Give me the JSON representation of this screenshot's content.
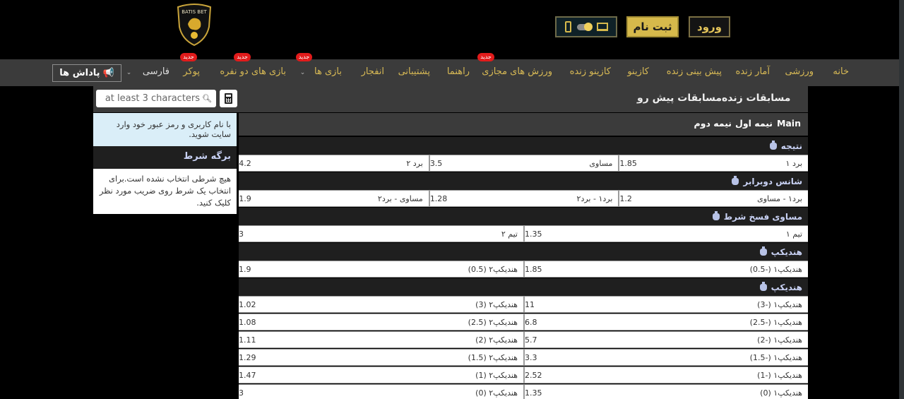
{
  "header": {
    "logo_text": "BATIS BET",
    "login_label": "ورود",
    "register_label": "ثبت نام",
    "device_toggle": {
      "left_icon": "phone-icon",
      "right_icon": "laptop-icon",
      "selected": "desktop"
    }
  },
  "nav": {
    "items": [
      {
        "label": "خانه",
        "badge": null
      },
      {
        "label": "ورزشی",
        "badge": null
      },
      {
        "label": "آمار زنده",
        "badge": null
      },
      {
        "label": "پیش بینی زنده",
        "badge": null
      },
      {
        "label": "کازینو",
        "badge": null
      },
      {
        "label": "کازینو زنده",
        "badge": null
      },
      {
        "label": "ورزش های مجازی",
        "badge": "جدید"
      },
      {
        "label": "راهنما",
        "badge": null
      },
      {
        "label": "پشتیبانی",
        "badge": null
      },
      {
        "label": "انفجار",
        "badge": null
      },
      {
        "label": "بازی ها",
        "badge": "جدید",
        "dropdown": true
      },
      {
        "label": "بازی های دو نفره",
        "badge": "جدید"
      },
      {
        "label": "پوکر",
        "badge": "جدید"
      }
    ],
    "language": "فارسی",
    "rewards_label": "پاداش ها"
  },
  "search": {
    "placeholder": "at least 3 characters"
  },
  "tabs": {
    "live": "مسابقات زنده",
    "upcoming": "مسابقات پیش رو"
  },
  "sidebar": {
    "login_note": "با نام کاربری و رمز عبور خود وارد سایت شوید.",
    "betslip_title": "برگه شرط",
    "betslip_empty": "هیچ شرطی انتخاب نشده است.برای انتخاب یک شرط روی ضریب مورد نظر کلیک کنید."
  },
  "subtabs": [
    "Main",
    "نیمه اول",
    "نیمه دوم"
  ],
  "markets": [
    {
      "title": "نتیجه",
      "rows": [
        [
          {
            "label": "برد ۱",
            "odd": "1.85"
          },
          {
            "label": "مساوی",
            "odd": "3.5"
          },
          {
            "label": "برد ۲",
            "odd": "4.2"
          }
        ]
      ]
    },
    {
      "title": "شانس دوبرابر",
      "rows": [
        [
          {
            "label": "برد۱ - مساوی",
            "odd": "1.2"
          },
          {
            "label": "برد۱ - برد۲",
            "odd": "1.28"
          },
          {
            "label": "مساوی - برد۲",
            "odd": "1.9"
          }
        ]
      ]
    },
    {
      "title": "مساوی فسخ شرط",
      "rows": [
        [
          {
            "label": "تیم ۱",
            "odd": "1.35"
          },
          {
            "label": "تیم ۲",
            "odd": "3"
          }
        ]
      ]
    },
    {
      "title": "هندیکپ",
      "rows": [
        [
          {
            "label": "هندیکپ۱  (-0.5)",
            "odd": "1.85"
          },
          {
            "label": "هندیکپ۲  (0.5)",
            "odd": "1.9"
          }
        ]
      ]
    },
    {
      "title": "هندیکپ",
      "rows": [
        [
          {
            "label": "هندیکپ۱  (-3)",
            "odd": "11"
          },
          {
            "label": "هندیکپ۲  (3)",
            "odd": "1.02"
          }
        ],
        [
          {
            "label": "هندیکپ۱  (-2.5)",
            "odd": "6.8"
          },
          {
            "label": "هندیکپ۲  (2.5)",
            "odd": "1.08"
          }
        ],
        [
          {
            "label": "هندیکپ۱  (-2)",
            "odd": "5.7"
          },
          {
            "label": "هندیکپ۲  (2)",
            "odd": "1.11"
          }
        ],
        [
          {
            "label": "هندیکپ۱  (-1.5)",
            "odd": "3.3"
          },
          {
            "label": "هندیکپ۲  (1.5)",
            "odd": "1.29"
          }
        ],
        [
          {
            "label": "هندیکپ۱  (-1)",
            "odd": "2.52"
          },
          {
            "label": "هندیکپ۲  (1)",
            "odd": "1.47"
          }
        ],
        [
          {
            "label": "هندیکپ۱  (0)",
            "odd": "1.35"
          },
          {
            "label": "هندیکپ۲  (0)",
            "odd": "3"
          }
        ]
      ]
    }
  ],
  "colors": {
    "accent_gold": "#d6b94b",
    "nav_bg": "#3b3b3b",
    "badge_red": "#e11b1b",
    "market_title": "#c9d2f5",
    "info_bg": "#daeef8"
  }
}
